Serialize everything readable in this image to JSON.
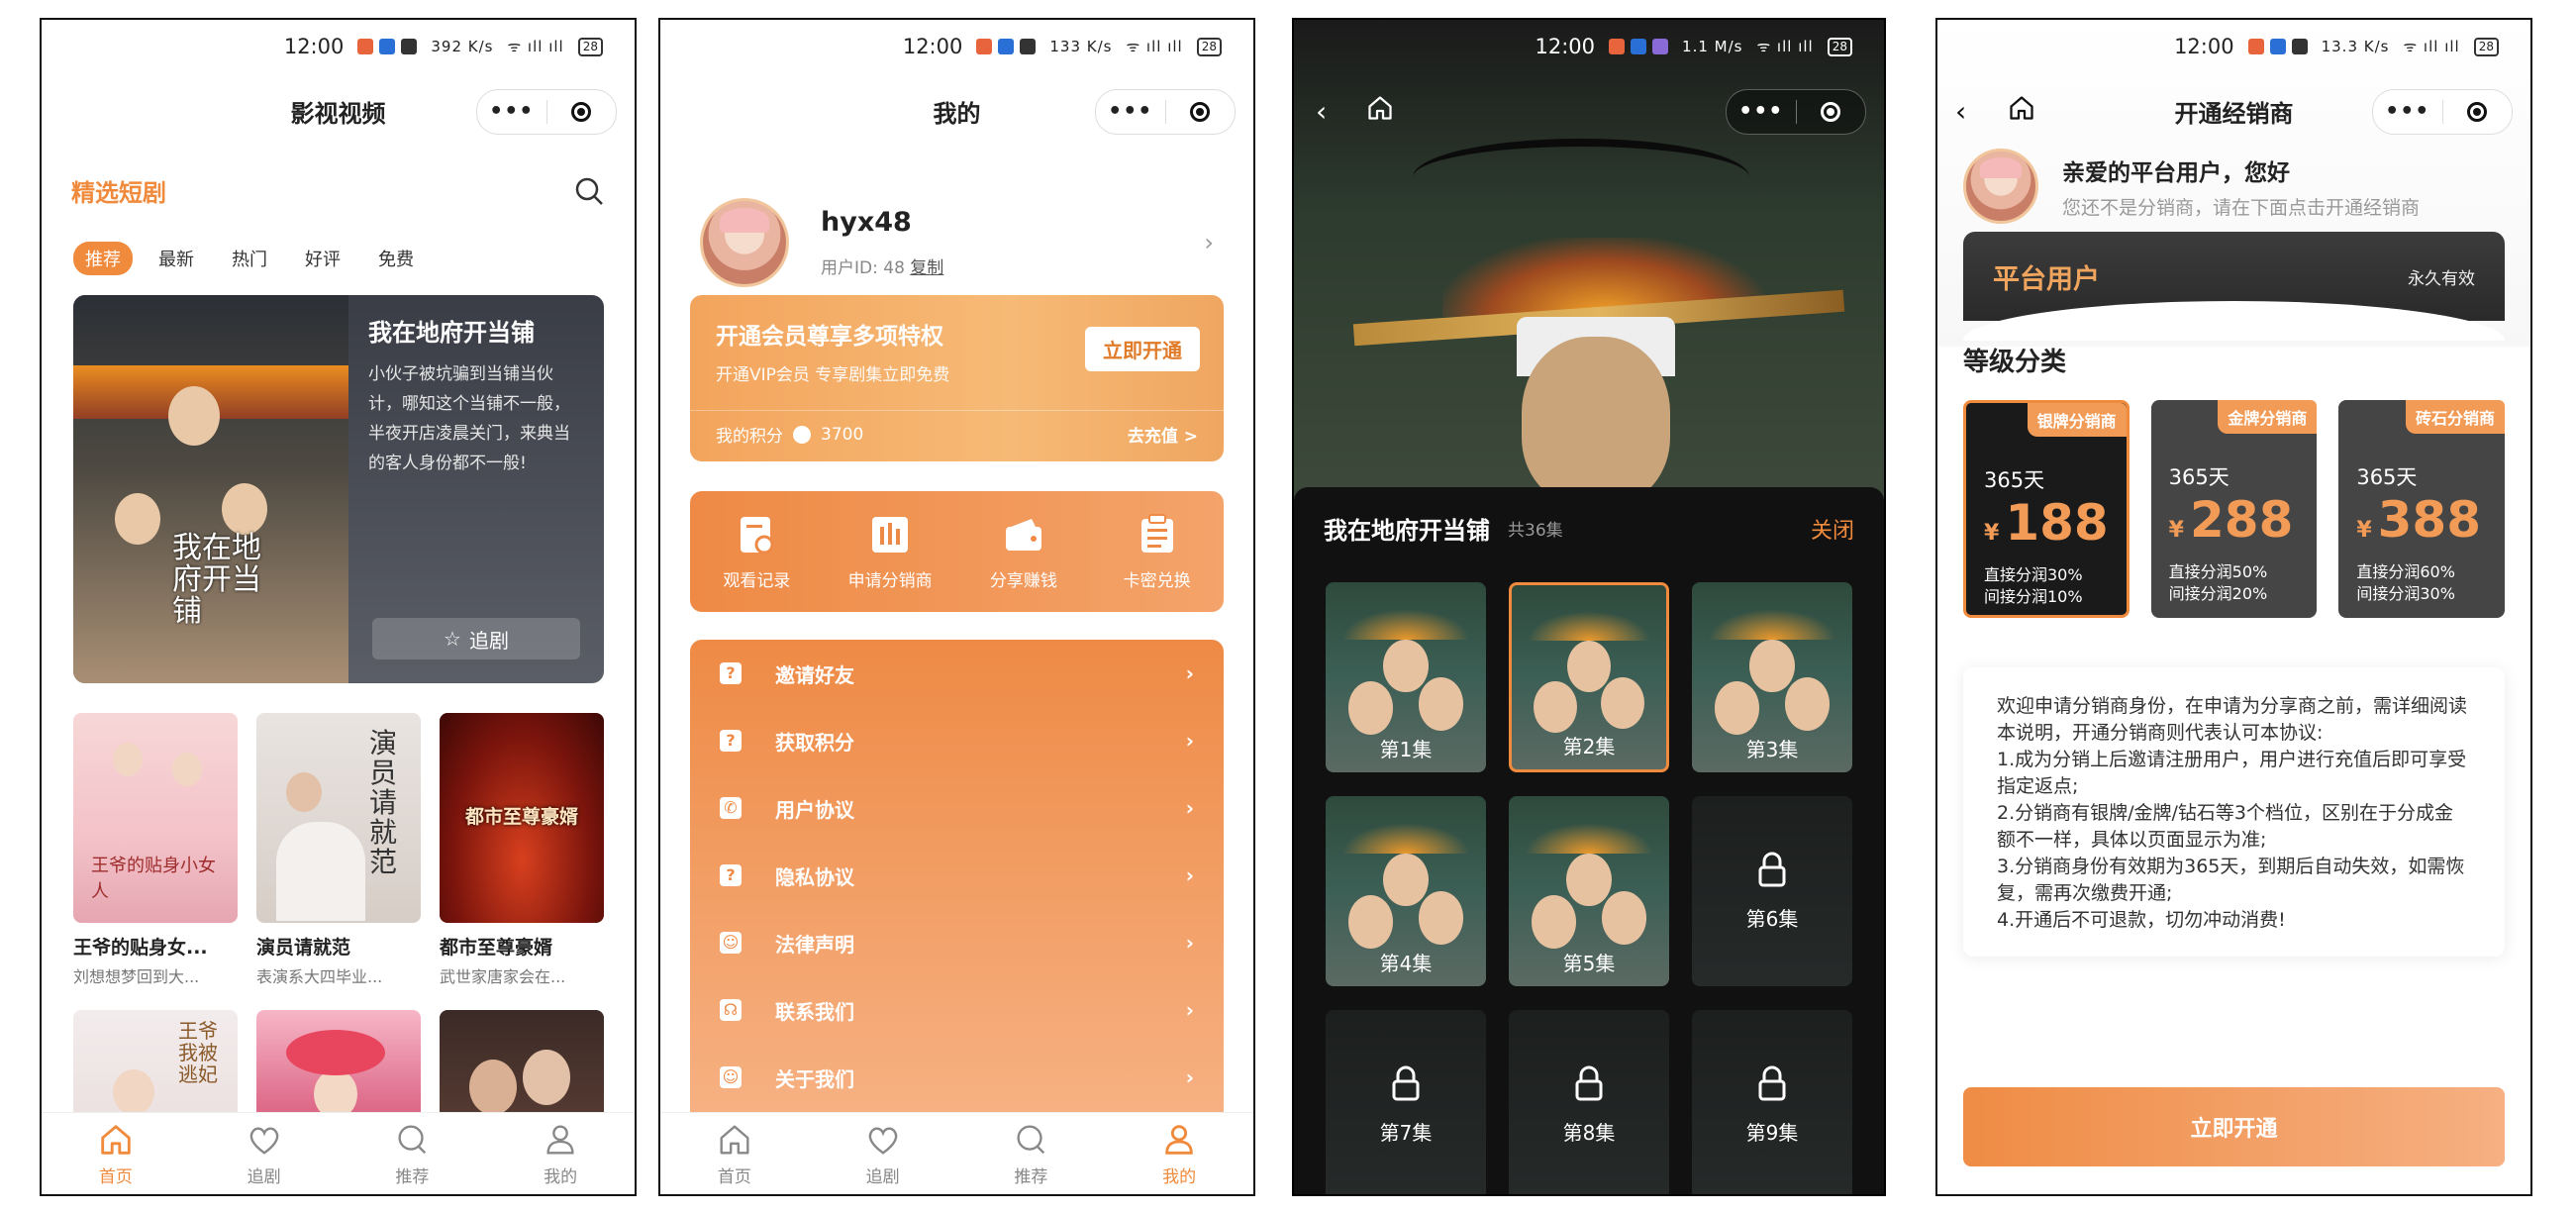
{
  "status": {
    "time": "12:00",
    "speed_p1": "392 K/s",
    "speed_p2": "133 K/s",
    "speed_p3": "1.1 M/s",
    "speed_p4": "13.3 K/s",
    "battery": "28"
  },
  "capsule": {
    "more": "•••"
  },
  "p1": {
    "nav_title": "影视视频",
    "section_title": "精选短剧",
    "filters": [
      "推荐",
      "最新",
      "热门",
      "好评",
      "免费"
    ],
    "featured": {
      "title": "我在地府开当铺",
      "desc": "小伙子被坑骗到当铺当伙计，哪知这个当铺不一般，半夜开店凌晨关门，来典当的客人身份都不一般!",
      "follow_label": "追剧",
      "poster_text": "我在地府开当铺"
    },
    "cards": [
      {
        "title": "王爷的贴身女...",
        "sub": "刘想想梦回到大..."
      },
      {
        "title": "演员请就范",
        "sub": "表演系大四毕业..."
      },
      {
        "title": "都市至尊豪婿",
        "sub": "武世家唐家会在..."
      }
    ],
    "card_posters": [
      "王爷的贴身小女人",
      "演员请就范",
      "都市至尊豪婿",
      "王爷我被逃妃",
      "",
      ""
    ]
  },
  "tabs": [
    "首页",
    "追剧",
    "推荐",
    "我的"
  ],
  "p2": {
    "nav_title": "我的",
    "username": "hyx48",
    "uid_label": "用户ID:",
    "uid": "48",
    "copy": "复制",
    "vip": {
      "title": "开通会员尊享多项特权",
      "sub": "开通VIP会员 专享剧集立即免费",
      "button": "立即开通",
      "points_label": "我的积分",
      "points": "3700",
      "recharge": "去充值 >"
    },
    "quick": [
      "观看记录",
      "申请分销商",
      "分享赚钱",
      "卡密兑换"
    ],
    "menu": [
      "邀请好友",
      "获取积分",
      "用户协议",
      "隐私协议",
      "法律声明",
      "联系我们",
      "关于我们"
    ]
  },
  "p3": {
    "title": "我在地府开当铺",
    "count": "共36集",
    "close": "关闭",
    "episodes": [
      "第1集",
      "第2集",
      "第3集",
      "第4集",
      "第5集",
      "第6集",
      "第7集",
      "第8集",
      "第9集"
    ]
  },
  "p4": {
    "nav_title": "开通经销商",
    "greet": "亲爱的平台用户，您好",
    "greet_sub": "您还不是分销商，请在下面点击开通经销商",
    "level_name": "平台用户",
    "level_valid": "永久有效",
    "section": "等级分类",
    "tiers": [
      {
        "tag": "银牌分销商",
        "days": "365天",
        "currency": "¥",
        "price": "188",
        "d1": "直接分润30%",
        "d2": "间接分润10%"
      },
      {
        "tag": "金牌分销商",
        "days": "365天",
        "currency": "¥",
        "price": "288",
        "d1": "直接分润50%",
        "d2": "间接分润20%"
      },
      {
        "tag": "砖石分销商",
        "days": "365天",
        "currency": "¥",
        "price": "388",
        "d1": "直接分润60%",
        "d2": "间接分润30%"
      }
    ],
    "notice": [
      "欢迎申请分销商身份，在申请为分享商之前，需详细阅读本说明，开通分销商则代表认可本协议:",
      "1.成为分销上后邀请注册用户，用户进行充值后即可享受指定返点;",
      "2.分销商有银牌/金牌/钻石等3个档位，区别在于分成金额不一样，具体以页面显示为准;",
      "3.分销商身份有效期为365天，到期后自动失效，如需恢复，需再次缴费开通;",
      "4.开通后不可退款，切勿冲动消费!"
    ],
    "open_button": "立即开通"
  }
}
